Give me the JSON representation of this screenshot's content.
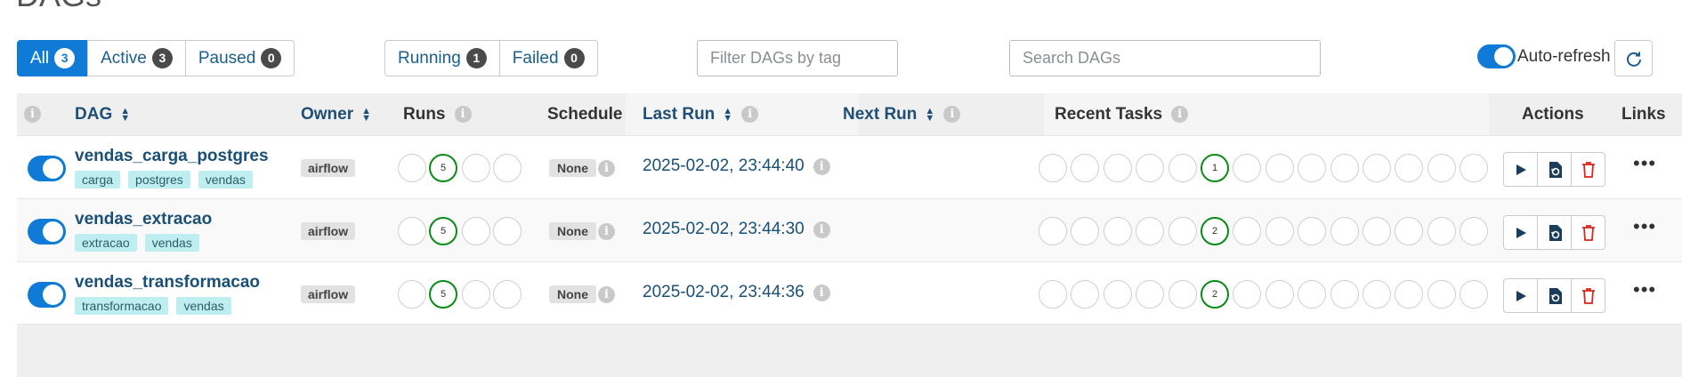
{
  "page": {
    "title": "DAGs"
  },
  "status_filters": [
    {
      "label": "All",
      "count": "3",
      "active": true
    },
    {
      "label": "Active",
      "count": "3",
      "active": false
    },
    {
      "label": "Paused",
      "count": "0",
      "active": false
    }
  ],
  "run_filters": [
    {
      "label": "Running",
      "count": "1"
    },
    {
      "label": "Failed",
      "count": "0"
    }
  ],
  "tag_filter": {
    "placeholder": "Filter DAGs by tag",
    "value": ""
  },
  "search": {
    "placeholder": "Search DAGs",
    "value": ""
  },
  "autorefresh": {
    "label": "Auto-refresh",
    "enabled": true
  },
  "columns": {
    "dag": "DAG",
    "owner": "Owner",
    "runs": "Runs",
    "schedule": "Schedule",
    "last_run": "Last Run",
    "next_run": "Next Run",
    "recent_tasks": "Recent Tasks",
    "actions": "Actions",
    "links": "Links"
  },
  "icons": {
    "info": "info-icon",
    "sort": "sort-icon",
    "refresh": "refresh-icon",
    "play": "play-icon",
    "refresh_dag": "refresh-dag-icon",
    "delete": "trash-icon",
    "more": "more-icon"
  },
  "colors": {
    "accent": "#0f7bd7",
    "success": "#0a8a17",
    "danger": "#d9261c",
    "tag_bg": "#bfeef0"
  },
  "dags": [
    {
      "name": "vendas_carga_postgres",
      "enabled": true,
      "tags": [
        "carga",
        "postgres",
        "vendas"
      ],
      "owner": "airflow",
      "runs_success": "5",
      "schedule": "None",
      "last_run": "2025-02-02, 23:44:40",
      "next_run": "",
      "recent_success": "1"
    },
    {
      "name": "vendas_extracao",
      "enabled": true,
      "tags": [
        "extracao",
        "vendas"
      ],
      "owner": "airflow",
      "runs_success": "5",
      "schedule": "None",
      "last_run": "2025-02-02, 23:44:30",
      "next_run": "",
      "recent_success": "2"
    },
    {
      "name": "vendas_transformacao",
      "enabled": true,
      "tags": [
        "transformacao",
        "vendas"
      ],
      "owner": "airflow",
      "runs_success": "5",
      "schedule": "None",
      "last_run": "2025-02-02, 23:44:36",
      "next_run": "",
      "recent_success": "2"
    }
  ]
}
